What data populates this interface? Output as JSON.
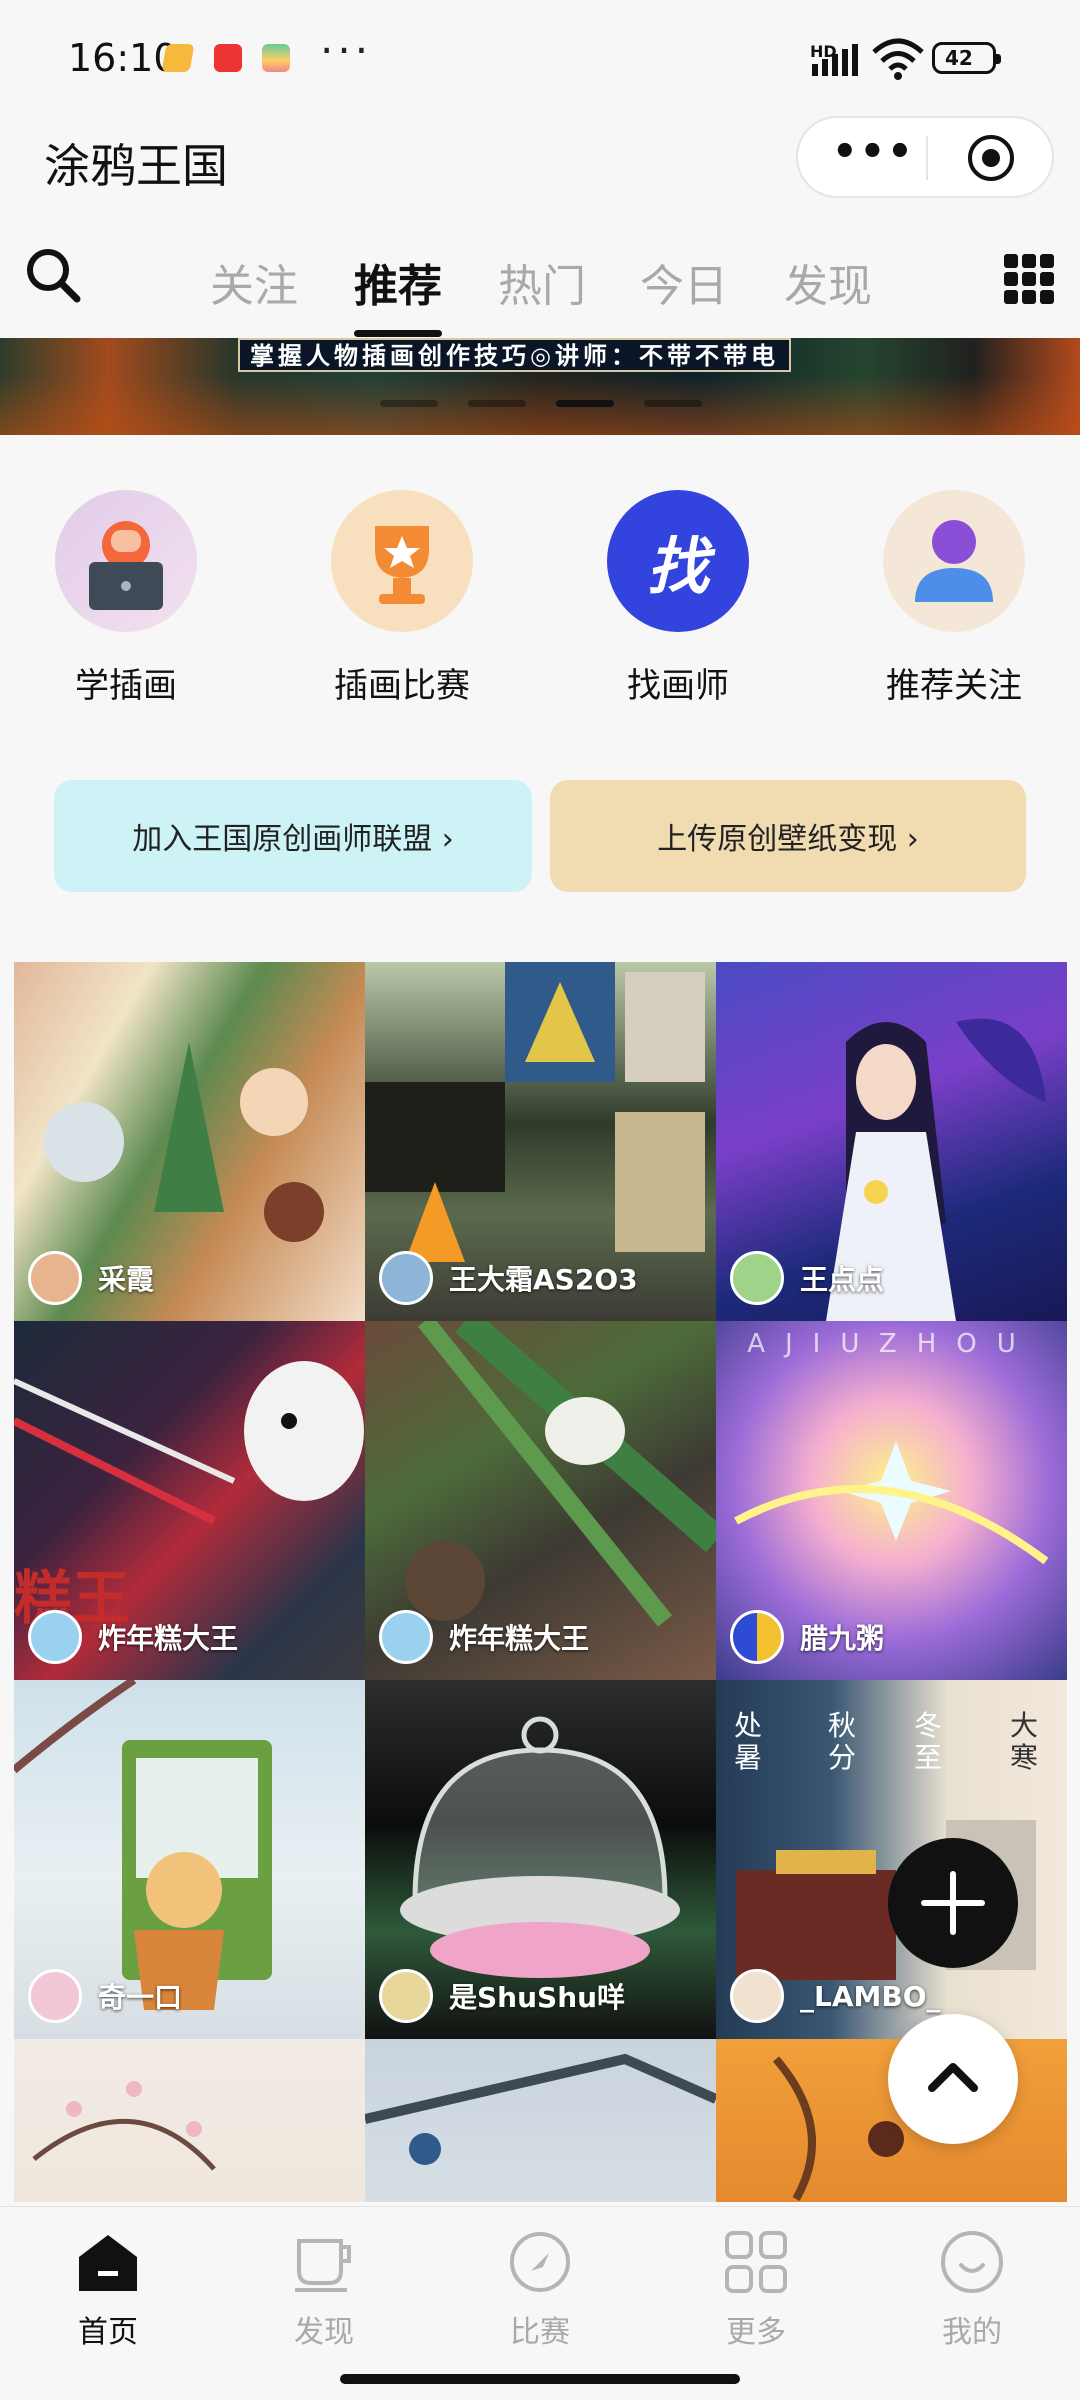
{
  "status_bar": {
    "time": "16:10",
    "more": "···",
    "hd": "HD",
    "battery": "42"
  },
  "header": {
    "title": "涂鸦王国",
    "more_icon": "more-dots-icon",
    "close_icon": "target-icon"
  },
  "tabs": [
    {
      "label": "关注",
      "active": false
    },
    {
      "label": "推荐",
      "active": true
    },
    {
      "label": "热门",
      "active": false
    },
    {
      "label": "今日",
      "active": false
    },
    {
      "label": "发现",
      "active": false
    }
  ],
  "banner": {
    "caption": "掌握人物插画创作技巧◎讲师：不带不带电"
  },
  "shortcuts": [
    {
      "label": "学插画",
      "icon": "laptop-person-icon",
      "color": "#e6d6ee"
    },
    {
      "label": "插画比赛",
      "icon": "trophy-icon",
      "color": "#f8dfbd"
    },
    {
      "label": "找画师",
      "icon": "find-artist-icon",
      "glyph": "找",
      "color": "#3343dd"
    },
    {
      "label": "推荐关注",
      "icon": "user-icon",
      "color": "#f5e7d7"
    }
  ],
  "promos": [
    {
      "label": "加入王国原创画师联盟 ›",
      "color": "#cdf3f6"
    },
    {
      "label": "上传原创壁纸变现 ›",
      "color": "#f1dcb2"
    }
  ],
  "feed": [
    {
      "author": "采霞"
    },
    {
      "author": "王大霜AS2O3"
    },
    {
      "author": "王点点"
    },
    {
      "author": "炸年糕大王"
    },
    {
      "author": "炸年糕大王"
    },
    {
      "author": "腊九粥"
    },
    {
      "author": "奇一口"
    },
    {
      "author": "是ShuShu咩"
    },
    {
      "author": "_LAMBO_"
    }
  ],
  "artwork_texts": {
    "cell_9": [
      "处暑",
      "秋分",
      "冬至",
      "大寒"
    ],
    "cell_6": "AJIUZHOU",
    "cell_4": "糕王"
  },
  "fabs": {
    "add_icon": "plus-icon",
    "top_icon": "chevron-up-icon"
  },
  "bottom_nav": [
    {
      "label": "首页",
      "icon": "home-icon",
      "active": true
    },
    {
      "label": "发现",
      "icon": "cup-icon",
      "active": false
    },
    {
      "label": "比赛",
      "icon": "compass-icon",
      "active": false
    },
    {
      "label": "更多",
      "icon": "grid-icon",
      "active": false
    },
    {
      "label": "我的",
      "icon": "smile-icon",
      "active": false
    }
  ]
}
